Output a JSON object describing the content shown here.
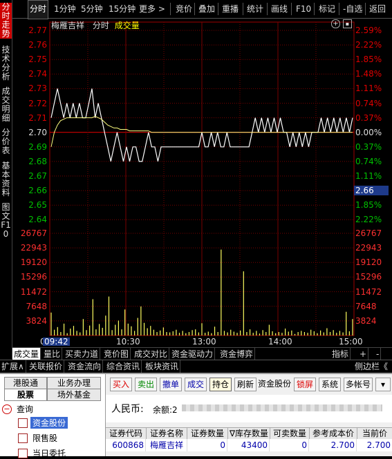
{
  "left_tabs": [
    {
      "label": "分时走势",
      "active": true
    },
    {
      "label": "技术分析"
    },
    {
      "label": "成交明细"
    },
    {
      "label": "分价表"
    },
    {
      "label": "基本资料"
    },
    {
      "label": "图文F10"
    }
  ],
  "toolbar": {
    "items": [
      "分时",
      "1分钟",
      "5分钟",
      "15分钟",
      "更多 >",
      "竞价",
      "叠加",
      "重播",
      "统计",
      "画线",
      "F10",
      "标记",
      "-自选",
      "返回"
    ]
  },
  "chart_header": {
    "stock_name": "梅雁吉祥",
    "mode": "分时",
    "indicator": "成交量"
  },
  "chart_data": {
    "type": "line",
    "price_axis": {
      "ticks": [
        "2.77",
        "2.76",
        "2.75",
        "2.74",
        "2.73",
        "2.72",
        "2.71",
        "2.70",
        "2.69",
        "2.68",
        "2.67",
        "2.66",
        "2.65",
        "2.64"
      ],
      "base": 2.7,
      "ylim": [
        2.64,
        2.77
      ]
    },
    "pct_axis": [
      "2.59%",
      "2.22%",
      "1.85%",
      "1.48%",
      "1.11%",
      "0.74%",
      "0.37%",
      "0.00%",
      "0.37%",
      "0.74%",
      "1.11%",
      "1.48%",
      "1.85%",
      "2.22%"
    ],
    "current_price_tag": "2.66",
    "volume_axis": {
      "ticks": [
        "26767",
        "22943",
        "19120",
        "15296",
        "11472",
        "7648",
        "3824"
      ],
      "ylim": [
        0,
        26767
      ]
    },
    "time_labels": [
      "09:30",
      "10:30",
      "13:00",
      "14:00",
      "15:00"
    ],
    "cursor_time": "09:42",
    "price_series": [
      2.71,
      2.72,
      2.73,
      2.72,
      2.71,
      2.72,
      2.71,
      2.72,
      2.71,
      2.72,
      2.71,
      2.71,
      2.72,
      2.73,
      2.71,
      2.72,
      2.71,
      2.7,
      2.69,
      2.68,
      2.69,
      2.7,
      2.69,
      2.68,
      2.69,
      2.68,
      2.69,
      2.69,
      2.68,
      2.68,
      2.69,
      2.7,
      2.69,
      2.69,
      2.68,
      2.69,
      2.69,
      2.69,
      2.69,
      2.69,
      2.69,
      2.69,
      2.69,
      2.69,
      2.69,
      2.69,
      2.69,
      2.69,
      2.7,
      2.69,
      2.69,
      2.7,
      2.69,
      2.7,
      2.69,
      2.69,
      2.7,
      2.69,
      2.69,
      2.69,
      2.69,
      2.69,
      2.69,
      2.69,
      2.7,
      2.71,
      2.7,
      2.71,
      2.7,
      2.71,
      2.7,
      2.71,
      2.7,
      2.71,
      2.7,
      2.7,
      2.69,
      2.7,
      2.69,
      2.7,
      2.69,
      2.7,
      2.69,
      2.7,
      2.7,
      2.7,
      2.71,
      2.7,
      2.71,
      2.7,
      2.71,
      2.7,
      2.71,
      2.7,
      2.71,
      2.7,
      2.71
    ],
    "avg_series": [
      2.69,
      2.7,
      2.705,
      2.708,
      2.709,
      2.71,
      2.71,
      2.71,
      2.71,
      2.71,
      2.71,
      2.71,
      2.71,
      2.71,
      2.711,
      2.71,
      2.709,
      2.707,
      2.705,
      2.704,
      2.703,
      2.703,
      2.702,
      2.702,
      2.702,
      2.701,
      2.701,
      2.701,
      2.701,
      2.701,
      2.701,
      2.701,
      2.7,
      2.7,
      2.7,
      2.7,
      2.7,
      2.7,
      2.7,
      2.7,
      2.7,
      2.7,
      2.7,
      2.7,
      2.7,
      2.7,
      2.7,
      2.7,
      2.7,
      2.7,
      2.7,
      2.7,
      2.7,
      2.7,
      2.7,
      2.7,
      2.7,
      2.7,
      2.7,
      2.7,
      2.7,
      2.7,
      2.7,
      2.7,
      2.7,
      2.7,
      2.7,
      2.7,
      2.7,
      2.7,
      2.7,
      2.7,
      2.7,
      2.7,
      2.7,
      2.7,
      2.7,
      2.7,
      2.7,
      2.7,
      2.7,
      2.7,
      2.7,
      2.7,
      2.7,
      2.7,
      2.7,
      2.7,
      2.7,
      2.7,
      2.7,
      2.7,
      2.7,
      2.7,
      2.7,
      2.7,
      2.7
    ],
    "volume_series": [
      6000,
      1500,
      2200,
      900,
      3100,
      600,
      1800,
      2500,
      1200,
      800,
      4300,
      1400,
      2600,
      9500,
      1600,
      3000,
      2000,
      5200,
      10200,
      1400,
      2800,
      3900,
      1600,
      6800,
      3100,
      2400,
      1200,
      4600,
      7600,
      3300,
      1900,
      2500,
      1500,
      900,
      1300,
      2100,
      900,
      800,
      1100,
      1500,
      700,
      1200,
      600,
      900,
      1400,
      1600,
      800,
      3200,
      700,
      1000,
      600,
      2300,
      900,
      22500,
      1200,
      800,
      1500,
      1000,
      700,
      1300,
      16800,
      900,
      1600,
      700,
      1200,
      500,
      1400,
      900,
      2800,
      1100,
      600,
      900,
      700,
      1800,
      1000,
      1300,
      400,
      900,
      1200,
      900,
      700,
      1500,
      1100,
      600,
      1300,
      800,
      1900,
      900,
      1400,
      700,
      1200,
      800,
      6200,
      1100,
      4300
    ],
    "grid": true
  },
  "chart_tabs": [
    {
      "label": "成交量",
      "active": true
    },
    {
      "label": "量比"
    },
    {
      "label": "买卖力道"
    },
    {
      "label": "竞价图"
    },
    {
      "label": "成交对比"
    },
    {
      "label": "资金驱动力"
    },
    {
      "label": "资金博弈"
    }
  ],
  "chart_tabs_right": [
    "指标",
    "+",
    "-"
  ],
  "info_bar": [
    "扩展∧",
    "关联报价",
    "资金流向",
    "综合资讯",
    "板块资讯",
    "侧边栏《"
  ],
  "trade_panel": {
    "nav_tabs": [
      "港股通",
      "业务办理",
      "股票",
      "场外基金"
    ],
    "tree": {
      "root": "查询",
      "items": [
        "资金股份",
        "限售股",
        "当日委托"
      ]
    },
    "buttons": [
      "买入",
      "卖出",
      "撤单",
      "成交",
      "持仓",
      "刷新",
      "资金股份",
      "锁屏",
      "系统",
      "多帐号"
    ],
    "currency_label": "人民币:",
    "balance_label": "余额:2",
    "table_headers": [
      "证券代码",
      "证券名称",
      "证券数量",
      "∇库存数量",
      "可卖数量",
      "参考成本价",
      "当前价"
    ],
    "rows": [
      {
        "code": "600868",
        "name": "梅雁吉祥",
        "qty": "0",
        "stock": "43400",
        "sellable": "0",
        "cost": "2.700",
        "price": "2.700"
      }
    ]
  },
  "colors": {
    "red": "#e00000",
    "green": "#00c000",
    "grid": "#7a0000",
    "price_line": "#ffffff",
    "avg_line": "#ffff80",
    "volume": "#ffff60"
  }
}
